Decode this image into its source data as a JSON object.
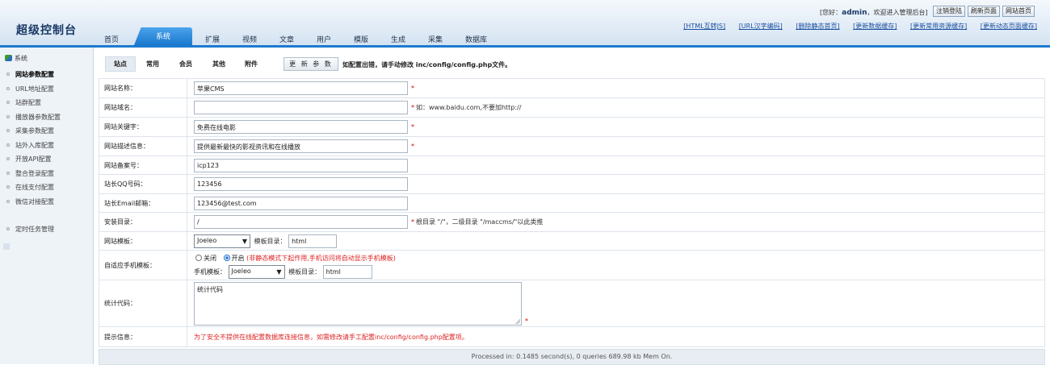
{
  "header": {
    "logo": "超级控制台",
    "welcome_prefix": "[您好：",
    "username": "admin",
    "welcome_suffix": "，欢迎进入管理后台]",
    "buttons": [
      "注销登陆",
      "刷新页面",
      "网站首页"
    ],
    "links": [
      "[HTML互转JS]",
      "[URL汉字编码]",
      "[删除静态首页]",
      "[更新数据缓存]",
      "[更新常用资源缓存]",
      "[更新动态页面缓存]"
    ],
    "tabs": [
      "首页",
      "系统",
      "扩展",
      "视频",
      "文章",
      "用户",
      "模版",
      "生成",
      "采集",
      "数据库"
    ]
  },
  "sidebar": {
    "title": "系统",
    "items": [
      "网站参数配置",
      "URL地址配置",
      "站群配置",
      "播放器参数配置",
      "采集参数配置",
      "站外入库配置",
      "开放API配置",
      "整合登录配置",
      "在线支付配置",
      "微信对接配置"
    ],
    "extra": "定时任务管理"
  },
  "subtabs": [
    "站点",
    "常用",
    "会员",
    "其他",
    "附件"
  ],
  "update_button": "更 新 参 数",
  "notice": "如配置出错，请手动修改 inc/config/config.php文件。",
  "form": {
    "site_name": {
      "label": "网站名称：",
      "value": "苹果CMS"
    },
    "site_domain": {
      "label": "网站域名：",
      "value": "",
      "hint": "如：www.baidu.com,不要加http://"
    },
    "site_keywords": {
      "label": "网站关键字：",
      "value": "免费在线电影"
    },
    "site_description": {
      "label": "网站描述信息：",
      "value": "提供最新最快的影视资讯和在线播放"
    },
    "icp": {
      "label": "网站备案号：",
      "value": "icp123"
    },
    "qq": {
      "label": "站长QQ号码：",
      "value": "123456"
    },
    "email": {
      "label": "站长Email邮箱：",
      "value": "123456@test.com"
    },
    "install_dir": {
      "label": "安装目录：",
      "value": "/",
      "hint": "根目录 \"/\"，二级目录 \"/maccms/\"以此类推"
    },
    "template": {
      "label": "网站模板：",
      "select": "Joeleo",
      "dir_label": "模板目录：",
      "dir_value": "html"
    },
    "mobile": {
      "label": "自适应手机模板：",
      "off": "关闭",
      "on": "开启",
      "note": "(非静态模式下起作用,手机访问将自动显示手机模板)",
      "tpl_label": "手机模板：",
      "select": "Joeleo",
      "dir_label": "模板目录：",
      "dir_value": "html"
    },
    "stats": {
      "label": "统计代码：",
      "value": "统计代码"
    },
    "tip": {
      "label": "提示信息：",
      "value": "为了安全不提供在线配置数据库连接信息，如需修改请手工配置inc/config/config.php配置项。"
    }
  },
  "footer": "Processed in: 0.1485 second(s), 0 queries 689.98 kb Mem On."
}
